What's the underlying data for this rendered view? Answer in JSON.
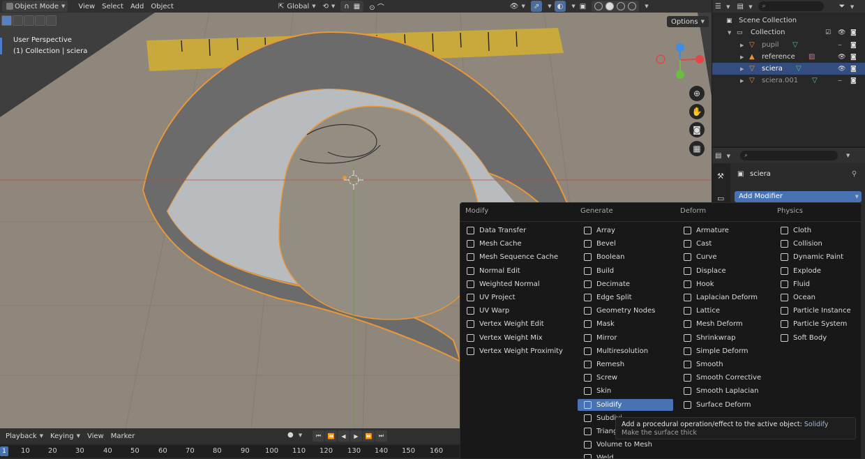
{
  "header": {
    "mode": "Object Mode",
    "menus": [
      "View",
      "Select",
      "Add",
      "Object"
    ],
    "transform_orientation": "Global"
  },
  "viewport": {
    "info_line1": "User Perspective",
    "info_line2": "(1) Collection | sciera",
    "options_label": "Options"
  },
  "outliner": {
    "search_placeholder": "",
    "scene_collection": "Scene Collection",
    "collection": "Collection",
    "items": [
      {
        "name": "pupil"
      },
      {
        "name": "reference"
      },
      {
        "name": "sciera"
      },
      {
        "name": "sciera.001"
      }
    ]
  },
  "properties": {
    "object_name": "sciera",
    "add_modifier_label": "Add Modifier"
  },
  "timeline": {
    "menus": [
      "Playback",
      "Keying",
      "View",
      "Marker"
    ],
    "current_frame": "1",
    "ticks": [
      "10",
      "20",
      "30",
      "40",
      "50",
      "60",
      "70",
      "80",
      "90",
      "100",
      "110",
      "120",
      "130",
      "140",
      "150",
      "160"
    ]
  },
  "menu": {
    "columns": [
      {
        "heading": "Modify",
        "items": [
          "Data Transfer",
          "Mesh Cache",
          "Mesh Sequence Cache",
          "Normal Edit",
          "Weighted Normal",
          "UV Project",
          "UV Warp",
          "Vertex Weight Edit",
          "Vertex Weight Mix",
          "Vertex Weight Proximity"
        ]
      },
      {
        "heading": "Generate",
        "items": [
          "Array",
          "Bevel",
          "Boolean",
          "Build",
          "Decimate",
          "Edge Split",
          "Geometry Nodes",
          "Mask",
          "Mirror",
          "Multiresolution",
          "Remesh",
          "Screw",
          "Skin",
          "Solidify",
          "Subdivi",
          "Triang",
          "Volume to Mesh",
          "Weld"
        ]
      },
      {
        "heading": "Deform",
        "items": [
          "Armature",
          "Cast",
          "Curve",
          "Displace",
          "Hook",
          "Laplacian Deform",
          "Lattice",
          "Mesh Deform",
          "Shrinkwrap",
          "Simple Deform",
          "Smooth",
          "Smooth Corrective",
          "Smooth Laplacian",
          "Surface Deform"
        ]
      },
      {
        "heading": "Physics",
        "items": [
          "Cloth",
          "Collision",
          "Dynamic Paint",
          "Explode",
          "Fluid",
          "Ocean",
          "Particle Instance",
          "Particle System",
          "Soft Body"
        ]
      }
    ],
    "highlighted": "Solidify"
  },
  "tooltip": {
    "main": "Add a procedural operation/effect to the active object:",
    "value": "Solidify",
    "sub": "Make the surface thick"
  },
  "colors": {
    "accent": "#4772b3",
    "selection_outline": "#e8973a",
    "axis_x": "#e3454b",
    "axis_y": "#6bbf3f",
    "axis_z": "#3d8de4"
  }
}
